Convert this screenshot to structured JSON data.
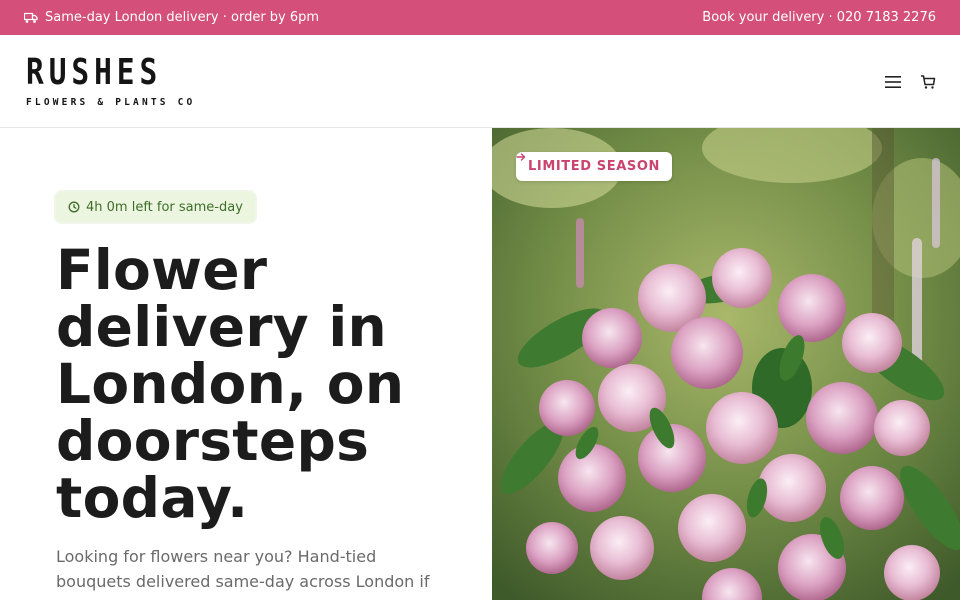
{
  "topbar": {
    "delivery_text": "Same-day London delivery · order by 6pm",
    "booking_text": "Book your delivery · 020 7183 2276",
    "background_color": "#d4507a"
  },
  "header": {
    "logo_text": "RUSHES",
    "logo_subtitle": "FLOWERS & PLANTS CO",
    "icons": [
      "menu-icon",
      "cart-icon"
    ]
  },
  "hero": {
    "timer_text": "4h 0m left for same-day",
    "headline": "Flower delivery in London, on doorsteps today.",
    "subcopy": "Looking for flowers near you? Hand-tied bouquets delivered same-day across London if",
    "season_badge": "LIMITED SEASON",
    "accent_color": "#c9446e",
    "timer_color": "#3f6d2a"
  }
}
